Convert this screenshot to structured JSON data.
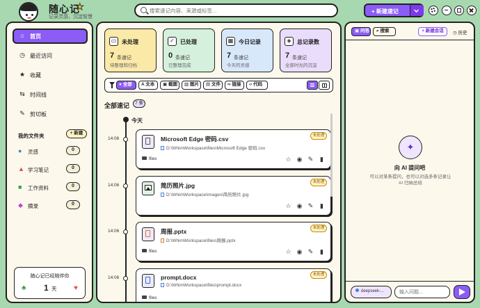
{
  "app": {
    "title": "随心记",
    "subtitle": "记录灵感，沉淀智慧"
  },
  "search": {
    "placeholder": "搜索速记内容、来源或标签..."
  },
  "toolbar": {
    "new_label": "+ 新建速记"
  },
  "nav": [
    {
      "label": "首页",
      "icon": "home-icon",
      "active": true
    },
    {
      "label": "最近访问",
      "icon": "clock-icon"
    },
    {
      "label": "收藏",
      "icon": "star-icon"
    },
    {
      "label": "时间线",
      "icon": "timeline-icon"
    },
    {
      "label": "剪切板",
      "icon": "pin-icon"
    }
  ],
  "folders": {
    "header": "我的文件夹",
    "add_label": "+ 新建",
    "items": [
      {
        "label": "灵感",
        "count": "0",
        "icon": "lightbulb-icon"
      },
      {
        "label": "学习笔记",
        "count": "0",
        "icon": "graduation-cap-icon"
      },
      {
        "label": "工作资料",
        "count": "0",
        "icon": "briefcase-icon"
      },
      {
        "label": "摘录",
        "count": "0",
        "icon": "bookmark-icon"
      }
    ]
  },
  "companion": {
    "text": "随心记已经陪伴你",
    "days": "1",
    "unit": "天"
  },
  "stats": [
    {
      "title": "未处理",
      "num": "7",
      "unit": "条速记",
      "desc": "待整理和归档",
      "bg": "#fbe9a8",
      "icon": "inbox-icon"
    },
    {
      "title": "已处理",
      "num": "0",
      "unit": "条速记",
      "desc": "已整理完成",
      "bg": "#d5f0dc",
      "icon": "check-square-icon"
    },
    {
      "title": "今日记录",
      "num": "7",
      "unit": "条速记",
      "desc": "今天的灵感",
      "bg": "#d8e8fb",
      "icon": "calendar-icon"
    },
    {
      "title": "总记录数",
      "num": "7",
      "unit": "条速记",
      "desc": "全部时光的沉淀",
      "bg": "#eadcfb",
      "icon": "stack-icon"
    }
  ],
  "filters": [
    {
      "label": "全部",
      "active": true
    },
    {
      "label": "文本"
    },
    {
      "label": "截图"
    },
    {
      "label": "图片"
    },
    {
      "label": "文件"
    },
    {
      "label": "链接"
    },
    {
      "label": "代码"
    }
  ],
  "section": {
    "title": "全部速记",
    "count": "7 条"
  },
  "timeline": {
    "day": "今天",
    "entries": [
      {
        "time": "14:06",
        "title": "Microsoft Edge 密码.csv",
        "path": "D:\\WhimWorkspace\\files\\Microsoft Edge 密码.csv",
        "tag": "files",
        "status": "未处理",
        "kind": "doc"
      },
      {
        "time": "14:06",
        "title": "简历照片.jpg",
        "path": "D:\\WhimWorkspace\\images\\简历照片.jpg",
        "tag": "",
        "status": "未处理",
        "kind": "img"
      },
      {
        "time": "14:06",
        "title": "周报.pptx",
        "path": "D:\\WhimWorkspace\\files\\周报.pptx",
        "tag": "files",
        "status": "未处理",
        "kind": "ppt"
      },
      {
        "time": "14:06",
        "title": "prompt.docx",
        "path": "D:\\WhimWorkspace\\files\\prompt.docx",
        "tag": "files",
        "status": "未处理",
        "kind": "word"
      }
    ]
  },
  "assistant": {
    "tabs": [
      "问答",
      "搜索"
    ],
    "new_chat": "+ 新建会话",
    "history": "历史",
    "title": "向 AI 提问吧",
    "desc": "可以对某条提问，也可以对选多条记录让 AI 归纳总结",
    "model": "deepseek-...",
    "input_placeholder": "输入问题..."
  }
}
